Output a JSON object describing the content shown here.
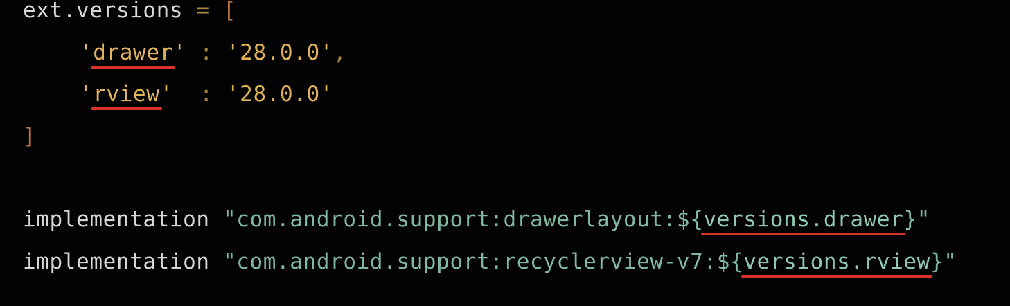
{
  "code": {
    "line1": {
      "ident": "ext.versions",
      "op": " = ",
      "open": "["
    },
    "line2": {
      "q1": "'",
      "key": "drawer",
      "q2": "'",
      "sep": " : ",
      "value": "'28.0.0'",
      "comma": ","
    },
    "line3": {
      "q1": "'",
      "key": "rview",
      "q2": "'",
      "sep": "  : ",
      "value": "'28.0.0'"
    },
    "line4": {
      "close": "]"
    },
    "line5": {
      "keyword": "implementation",
      "space": " ",
      "str_start": "\"com.android.support:drawerlayout:${",
      "ref": "versions.drawer",
      "str_end": "}\""
    },
    "line6": {
      "keyword": "implementation",
      "space": " ",
      "str_start": "\"com.android.support:recyclerview-v7:${",
      "ref": "versions.rview",
      "str_end": "}\""
    }
  },
  "colors": {
    "background": "#020202",
    "plain_text": "#d7d7d7",
    "orange_string": "#e2b45a",
    "green_string": "#7fb7a3",
    "underline": "#d9312b"
  }
}
